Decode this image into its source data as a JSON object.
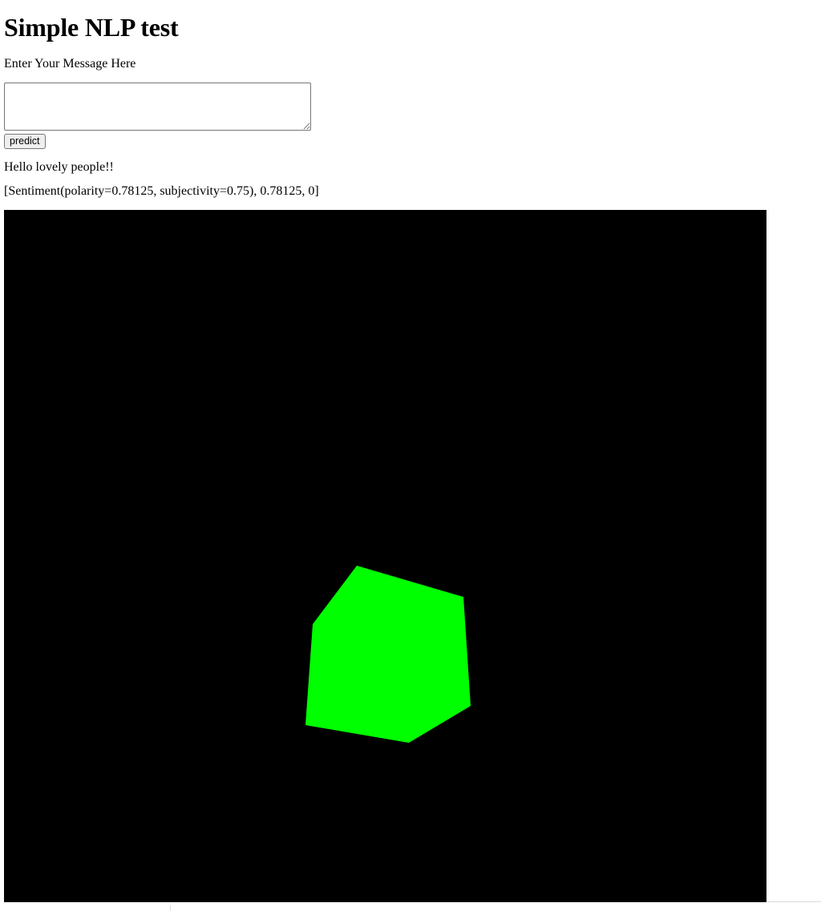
{
  "page": {
    "title": "Simple NLP test",
    "prompt_label": "Enter Your Message Here",
    "message_input": {
      "value": "",
      "placeholder": ""
    },
    "predict_button_label": "predict",
    "echo_text": "Hello lovely people!!",
    "result_text": "[Sentiment(polarity=0.78125, subjectivity=0.75), 0.78125, 0]"
  },
  "scene": {
    "background_color": "#000000",
    "object": "cube",
    "object_color": "#00ff00"
  }
}
